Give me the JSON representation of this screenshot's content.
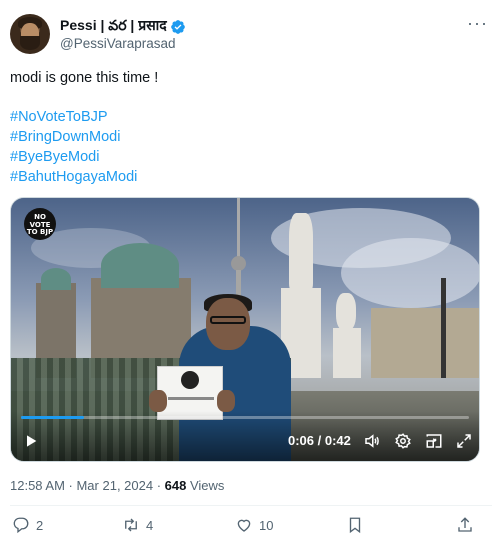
{
  "author": {
    "display_name": "Pessi | వర | प्रसाद",
    "handle": "@PessiVaraprasad",
    "verified": true
  },
  "more_icon": "more-horizontal-icon",
  "tweet": {
    "text": "modi is gone this time !",
    "hashtags": [
      "#NoVoteToBJP",
      "#BringDownModi",
      "#ByeByeModi",
      "#BahutHogayaModi"
    ]
  },
  "video": {
    "logo_text": "NO VOTE TO BJP",
    "time_display": "0:06 / 0:42",
    "progress_fraction": 0.14,
    "icons": [
      "play-icon",
      "volume-icon",
      "settings-icon",
      "pip-icon",
      "fullscreen-icon"
    ]
  },
  "meta": {
    "timestamp": "12:58 AM · Mar 21, 2024 · ",
    "views_count": "648",
    "views_label": " Views"
  },
  "actions": {
    "replies": "2",
    "reposts": "4",
    "likes": "10"
  },
  "colors": {
    "accent": "#1d9bf0",
    "text": "#0f1419",
    "secondary": "#536471"
  }
}
